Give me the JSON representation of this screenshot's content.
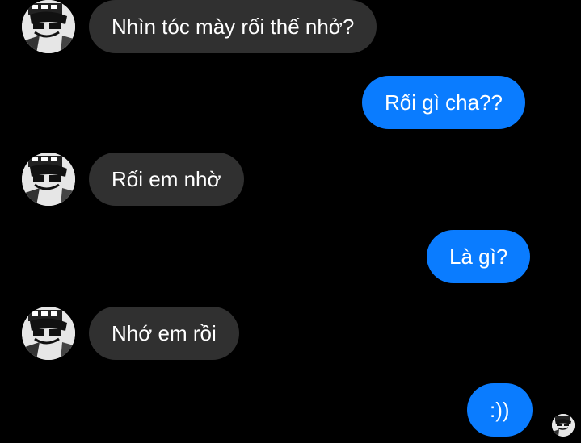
{
  "colors": {
    "background": "#000000",
    "incoming_bubble": "#303030",
    "outgoing_bubble": "#0a7cff",
    "text": "#ffffff"
  },
  "messages": [
    {
      "direction": "incoming",
      "text": "Nhìn tóc mày rối thế nhở?",
      "avatar": "contact-avatar"
    },
    {
      "direction": "outgoing",
      "text": "Rối gì cha??"
    },
    {
      "direction": "incoming",
      "text": "Rối em nhờ",
      "avatar": "contact-avatar"
    },
    {
      "direction": "outgoing",
      "text": "Là gì?"
    },
    {
      "direction": "incoming",
      "text": "Nhớ em rồi",
      "avatar": "contact-avatar"
    },
    {
      "direction": "outgoing",
      "text": ":))",
      "seen_avatar": "seen-indicator-avatar"
    }
  ]
}
